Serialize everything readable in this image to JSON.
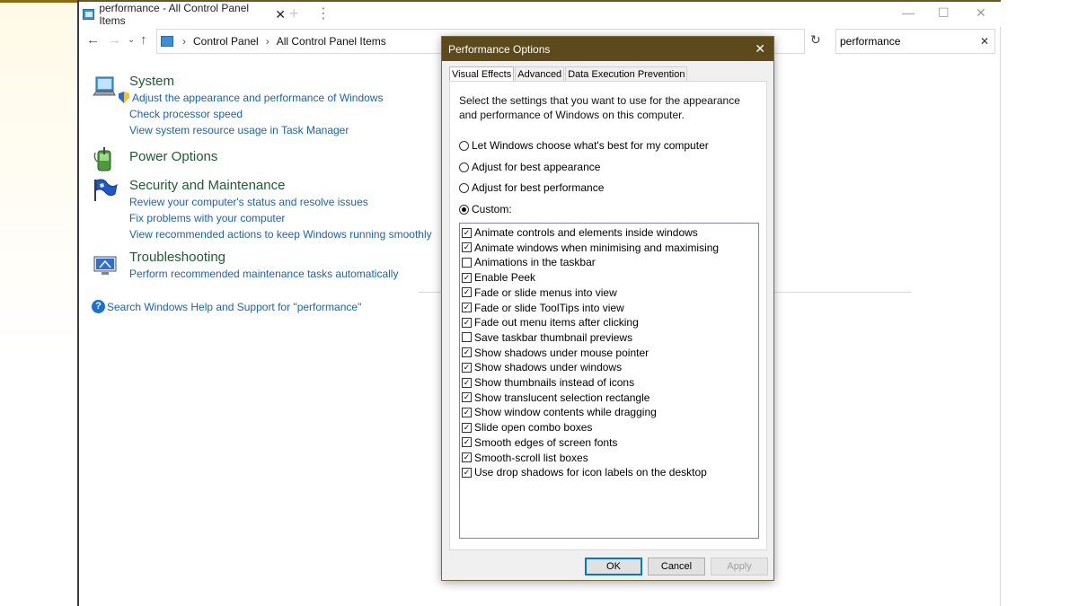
{
  "tab": {
    "title": "performance - All Control Panel Items"
  },
  "address": {
    "crumbs": [
      "Control Panel",
      "All Control Panel Items"
    ],
    "search_value": "performance"
  },
  "groups": [
    {
      "title": "System",
      "links": [
        "Adjust the appearance and performance of Windows",
        "Check processor speed",
        "View system resource usage in Task Manager"
      ]
    },
    {
      "title": "Power Options",
      "links": []
    },
    {
      "title": "Security and Maintenance",
      "links": [
        "Review your computer's status and resolve issues",
        "Fix problems with your computer",
        "View recommended actions to keep Windows running smoothly"
      ]
    },
    {
      "title": "Troubleshooting",
      "links": [
        "Perform recommended maintenance tasks automatically"
      ]
    }
  ],
  "help_link": "Search Windows Help and Support for \"performance\"",
  "dialog": {
    "title": "Performance Options",
    "tabs": [
      "Visual Effects",
      "Advanced",
      "Data Execution Prevention"
    ],
    "description": "Select the settings that you want to use for the appearance and performance of Windows on this computer.",
    "radios": [
      {
        "label": "Let Windows choose what's best for my computer",
        "checked": false
      },
      {
        "label": "Adjust for best appearance",
        "checked": false
      },
      {
        "label": "Adjust for best performance",
        "checked": false
      },
      {
        "label": "Custom:",
        "checked": true
      }
    ],
    "options": [
      {
        "label": "Animate controls and elements inside windows",
        "checked": true
      },
      {
        "label": "Animate windows when minimising and maximising",
        "checked": true
      },
      {
        "label": "Animations in the taskbar",
        "checked": false
      },
      {
        "label": "Enable Peek",
        "checked": true
      },
      {
        "label": "Fade or slide menus into view",
        "checked": true
      },
      {
        "label": "Fade or slide ToolTips into view",
        "checked": true
      },
      {
        "label": "Fade out menu items after clicking",
        "checked": true
      },
      {
        "label": "Save taskbar thumbnail previews",
        "checked": false
      },
      {
        "label": "Show shadows under mouse pointer",
        "checked": true
      },
      {
        "label": "Show shadows under windows",
        "checked": true
      },
      {
        "label": "Show thumbnails instead of icons",
        "checked": true
      },
      {
        "label": "Show translucent selection rectangle",
        "checked": true
      },
      {
        "label": "Show window contents while dragging",
        "checked": true
      },
      {
        "label": "Slide open combo boxes",
        "checked": true
      },
      {
        "label": "Smooth edges of screen fonts",
        "checked": true
      },
      {
        "label": "Smooth-scroll list boxes",
        "checked": true
      },
      {
        "label": "Use drop shadows for icon labels on the desktop",
        "checked": true
      }
    ],
    "buttons": {
      "ok": "OK",
      "cancel": "Cancel",
      "apply": "Apply"
    }
  }
}
